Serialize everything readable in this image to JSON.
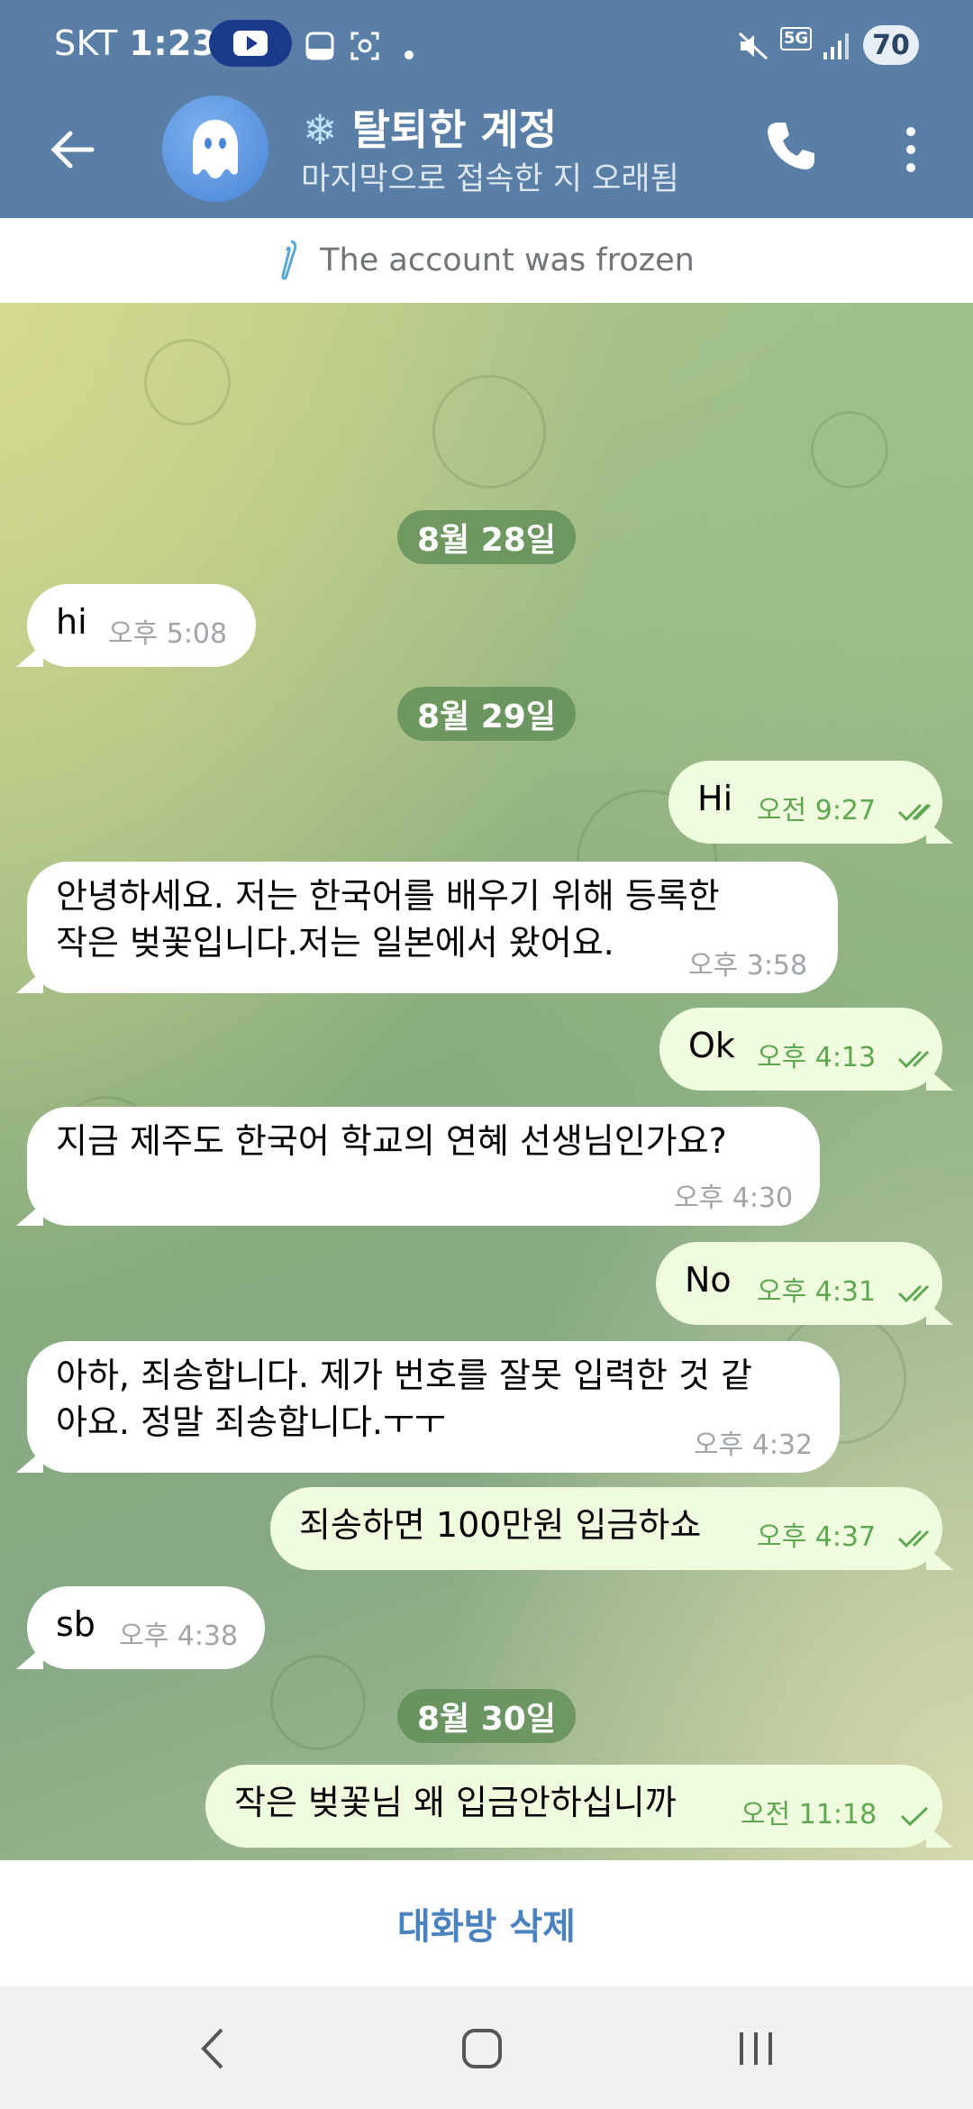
{
  "status_bar": {
    "carrier": "SKT",
    "time": "1:23",
    "battery": "70",
    "network": "5G"
  },
  "header": {
    "title": "탈퇴한 계정",
    "title_icon": "❄",
    "subtitle": "마지막으로 접속한 지 오래됨"
  },
  "notice": {
    "text": "The account was frozen"
  },
  "chat": {
    "dates": [
      "8월 28일",
      "8월 29일",
      "8월 30일"
    ],
    "messages": [
      {
        "dir": "in",
        "lines": [
          "hi"
        ],
        "time": "오후 5:08"
      },
      {
        "dir": "out",
        "lines": [
          "Hi"
        ],
        "time": "오전 9:27",
        "status": "read"
      },
      {
        "dir": "in",
        "lines": [
          "안녕하세요. 저는 한국어를 배우기 위해 등록한",
          "작은 벚꽃입니다.저는 일본에서 왔어요."
        ],
        "time": "오후 3:58"
      },
      {
        "dir": "out",
        "lines": [
          "Ok"
        ],
        "time": "오후 4:13",
        "status": "read"
      },
      {
        "dir": "in",
        "lines": [
          "지금 제주도 한국어 학교의 연혜 선생님인가요?"
        ],
        "time": "오후 4:30"
      },
      {
        "dir": "out",
        "lines": [
          "No"
        ],
        "time": "오후 4:31",
        "status": "read"
      },
      {
        "dir": "in",
        "lines": [
          "아하, 죄송합니다. 제가 번호를 잘못 입력한 것 같",
          "아요. 정말 죄송합니다.ㅜㅜ"
        ],
        "time": "오후 4:32"
      },
      {
        "dir": "out",
        "lines": [
          "죄송하면 100만원 입금하쇼"
        ],
        "time": "오후 4:37",
        "status": "read"
      },
      {
        "dir": "in",
        "lines": [
          "sb"
        ],
        "time": "오후 4:38"
      },
      {
        "dir": "out",
        "lines": [
          "작은 벚꽃님 왜 입금안하십니까"
        ],
        "time": "오전 11:18",
        "status": "sent"
      }
    ]
  },
  "bottom": {
    "delete_label": "대화방 삭제"
  },
  "colors": {
    "header": "#5a7fa6",
    "outgoing_bubble": "#effdde",
    "incoming_bubble": "#ffffff",
    "accent": "#4a82c0",
    "check": "#5fa751"
  }
}
